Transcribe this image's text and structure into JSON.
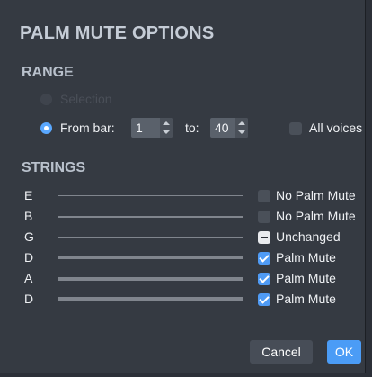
{
  "dialog": {
    "title": "PALM MUTE OPTIONS"
  },
  "range": {
    "heading": "RANGE",
    "selection_label": "Selection",
    "from_bar_label": "From bar:",
    "from_bar_value": "1",
    "to_label": "to:",
    "to_value": "40",
    "all_voices_label": "All voices"
  },
  "strings": {
    "heading": "STRINGS",
    "rows": [
      {
        "name": "E",
        "state_label": "No Palm Mute",
        "state": "unchecked"
      },
      {
        "name": "B",
        "state_label": "No Palm Mute",
        "state": "unchecked"
      },
      {
        "name": "G",
        "state_label": "Unchanged",
        "state": "mixed"
      },
      {
        "name": "D",
        "state_label": "Palm Mute",
        "state": "checked"
      },
      {
        "name": "A",
        "state_label": "Palm Mute",
        "state": "checked"
      },
      {
        "name": "D",
        "state_label": "Palm Mute",
        "state": "checked"
      }
    ]
  },
  "buttons": {
    "cancel": "Cancel",
    "ok": "OK"
  },
  "colors": {
    "background": "#353a42",
    "accent": "#4b9cf6",
    "text": "#eef0f3"
  }
}
